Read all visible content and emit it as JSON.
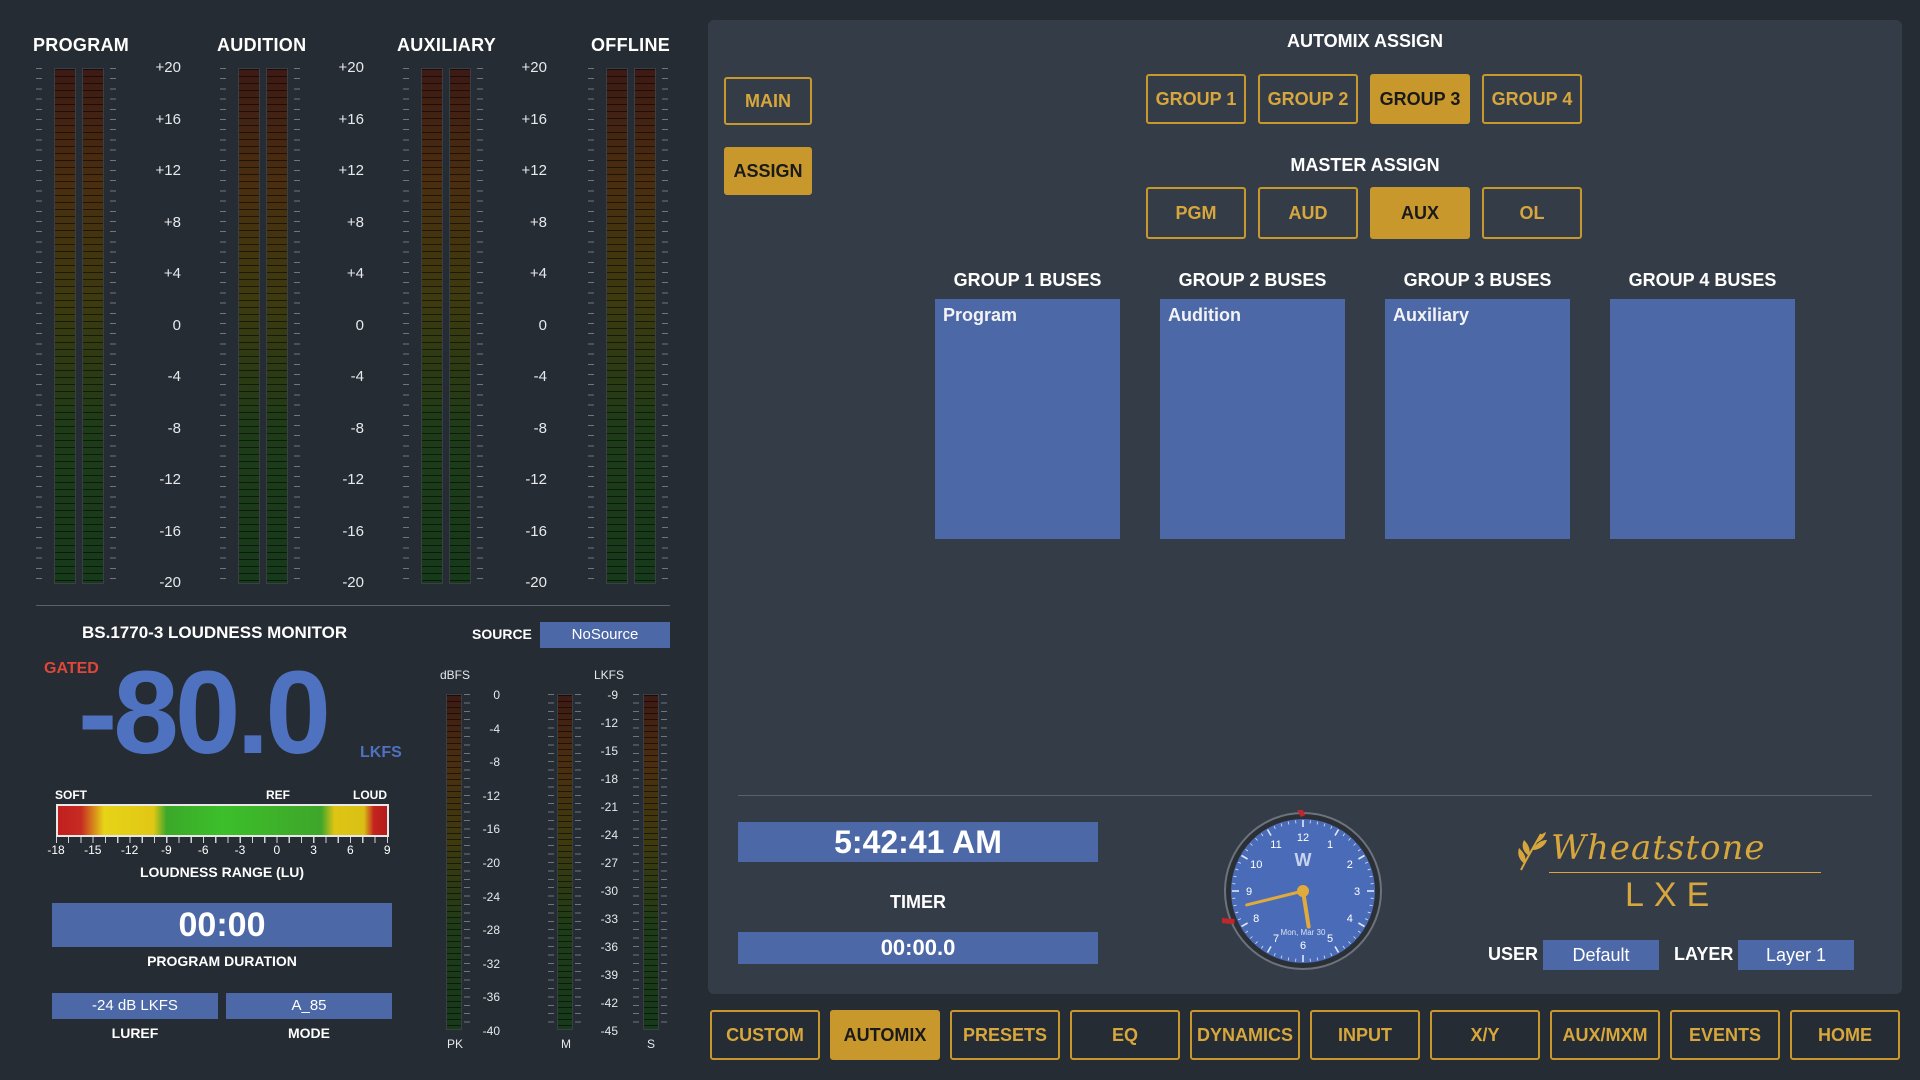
{
  "meters": {
    "titles": [
      "PROGRAM",
      "AUDITION",
      "AUXILIARY",
      "OFFLINE"
    ],
    "scale": [
      "+20",
      "+16",
      "+12",
      "+8",
      "+4",
      "0",
      "-4",
      "-8",
      "-12",
      "-16",
      "-20"
    ]
  },
  "loudness": {
    "title": "BS.1770-3 LOUDNESS MONITOR",
    "source_label": "SOURCE",
    "source_value": "NoSource",
    "gated": "GATED",
    "value": "-80.0",
    "unit": "LKFS",
    "range_soft": "SOFT",
    "range_ref": "REF",
    "range_loud": "LOUD",
    "range_scale": [
      "-18",
      "-15",
      "-12",
      "-9",
      "-6",
      "-3",
      "0",
      "3",
      "6",
      "9"
    ],
    "range_caption": "LOUDNESS RANGE (LU)",
    "duration": "00:00",
    "duration_caption": "PROGRAM DURATION",
    "luref_value": "-24 dB LKFS",
    "luref_caption": "LUREF",
    "mode_value": "A_85",
    "mode_caption": "MODE",
    "dbfs_label": "dBFS",
    "dbfs_scale": [
      "0",
      "-4",
      "-8",
      "-12",
      "-16",
      "-20",
      "-24",
      "-28",
      "-32",
      "-36",
      "-40"
    ],
    "lkfs_label": "LKFS",
    "lkfs_scale": [
      "-9",
      "-12",
      "-15",
      "-18",
      "-21",
      "-24",
      "-27",
      "-30",
      "-33",
      "-36",
      "-39",
      "-42",
      "-45"
    ],
    "pk_label": "PK",
    "m_label": "M",
    "s_label": "S"
  },
  "panel": {
    "main_label": "MAIN",
    "assign_label": "ASSIGN",
    "automix_title": "AUTOMIX ASSIGN",
    "groups": [
      "GROUP 1",
      "GROUP 2",
      "GROUP 3",
      "GROUP 4"
    ],
    "active_group": 2,
    "master_title": "MASTER ASSIGN",
    "masters": [
      "PGM",
      "AUD",
      "AUX",
      "OL"
    ],
    "active_master": 2,
    "bus_titles": [
      "GROUP 1 BUSES",
      "GROUP 2 BUSES",
      "GROUP 3 BUSES",
      "GROUP 4 BUSES"
    ],
    "bus_contents": [
      "Program",
      "Audition",
      "Auxiliary",
      ""
    ]
  },
  "status": {
    "time": "5:42:41 AM",
    "timer_label": "TIMER",
    "timer_value": "00:00.0",
    "clock_date": "Mon, Mar 30",
    "clock_numbers": [
      "12",
      "1",
      "2",
      "3",
      "4",
      "5",
      "6",
      "7",
      "8",
      "9",
      "10",
      "11"
    ],
    "clock_logo": "W",
    "clock_time": {
      "hour": 5,
      "minute": 42,
      "second": 41
    },
    "brand_name": "Wheatstone",
    "brand_sub": "LXE",
    "user_label": "USER",
    "user_value": "Default",
    "layer_label": "LAYER",
    "layer_value": "Layer 1"
  },
  "nav": {
    "items": [
      "CUSTOM",
      "AUTOMIX",
      "PRESETS",
      "EQ",
      "DYNAMICS",
      "INPUT",
      "X/Y",
      "AUX/MXM",
      "EVENTS",
      "HOME"
    ],
    "active": 1
  },
  "colors": {
    "accent": "#c8982d",
    "panel_blue": "#4c68a7",
    "loudness_value": "#4f72c0",
    "gated": "#e0463a"
  }
}
